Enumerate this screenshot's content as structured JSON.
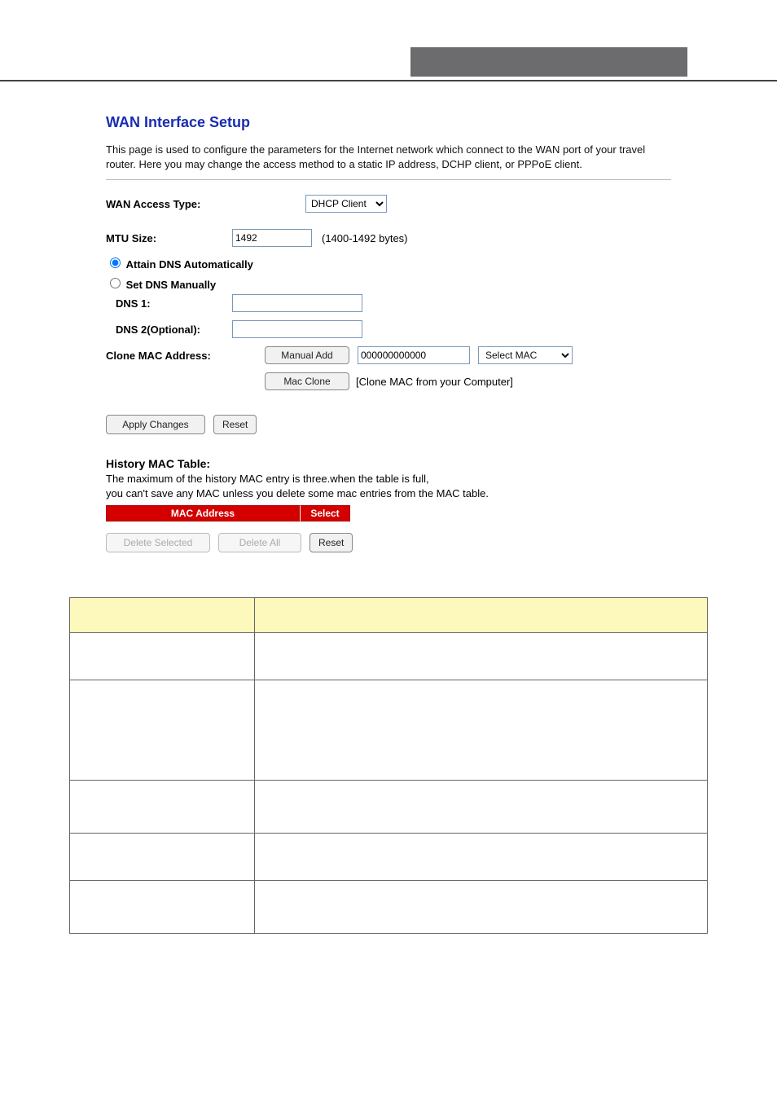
{
  "page": {
    "title": "WAN Interface Setup",
    "description": "This page is used to configure the parameters for the Internet network which connect to the WAN port of your travel router. Here you may change the access method to a static IP address, DCHP client, or PPPoE client."
  },
  "form": {
    "wan_access_label": "WAN Access Type:",
    "wan_access_value": "DHCP Client",
    "mtu_label": "MTU Size:",
    "mtu_value": "1492",
    "mtu_hint": "(1400-1492 bytes)",
    "dns_auto_label": "Attain DNS Automatically",
    "dns_manual_label": "Set DNS Manually",
    "dns1_label": "DNS 1:",
    "dns1_value": "",
    "dns2_label": "DNS 2(Optional):",
    "dns2_value": "",
    "clone_label": "Clone MAC Address:",
    "manual_add_btn": "Manual Add",
    "mac_value": "000000000000",
    "select_mac_label": "Select MAC",
    "mac_clone_btn": "Mac Clone",
    "mac_clone_note": "[Clone MAC from your Computer]",
    "apply_btn": "Apply Changes",
    "reset_btn": "Reset"
  },
  "history": {
    "title": "History MAC Table:",
    "desc_line1": "The maximum of the history MAC entry is three.when the table is full,",
    "desc_line2": "you can't save any MAC unless you delete some mac entries from the MAC table.",
    "col_mac": "MAC Address",
    "col_select": "Select",
    "delete_selected_btn": "Delete Selected",
    "delete_all_btn": "Delete All",
    "reset_btn": "Reset"
  }
}
